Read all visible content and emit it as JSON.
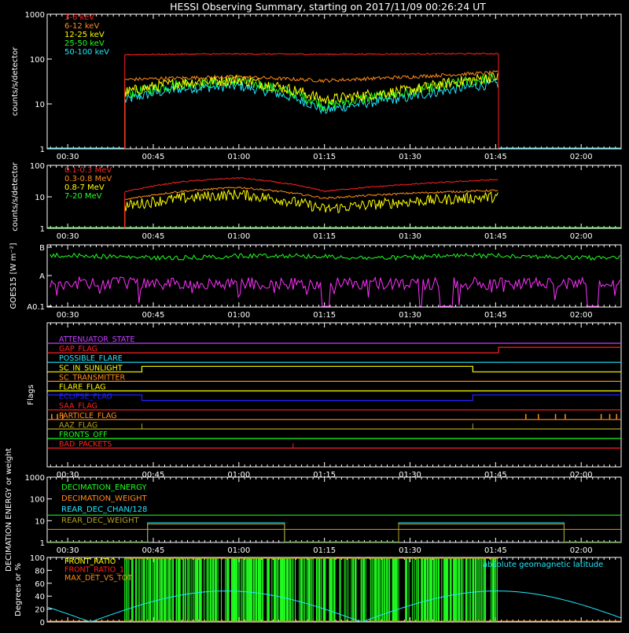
{
  "title": "HESSI Observing Summary, starting on 2017/11/09 00:26:24 UT",
  "time_axis": {
    "start": "00:26:24",
    "end": "02:07:00",
    "tick_labels": [
      "00:30",
      "00:45",
      "01:00",
      "01:15",
      "01:30",
      "01:45",
      "02:00"
    ],
    "tick_minutes": [
      30,
      45,
      60,
      75,
      90,
      105,
      120
    ]
  },
  "colors": {
    "red": "#ff2020",
    "orange": "#ff8c1a",
    "yellow": "#ffff00",
    "green": "#20ff20",
    "cyan": "#20e8ff",
    "magenta": "#ff30ff",
    "blue": "#2020ff",
    "purple": "#c040ff",
    "olive": "#b0a020",
    "white": "#ffffff"
  },
  "chart_data": [
    {
      "type": "line",
      "ylabel": "counts/s/detector",
      "yscale": "log",
      "ylim": [
        1,
        1000
      ],
      "ytick_labels": [
        "1",
        "10",
        "100",
        "1000"
      ],
      "ytick_values": [
        1,
        10,
        100,
        1000
      ],
      "observation_window": [
        "00:40:00",
        "01:45:30"
      ],
      "series": [
        {
          "name": "3-6 keV",
          "color": "#ff2020",
          "x": [
            "00:40",
            "00:50",
            "01:00",
            "01:15",
            "01:30",
            "01:45"
          ],
          "y": [
            125,
            128,
            130,
            128,
            130,
            132
          ]
        },
        {
          "name": "6-12 keV",
          "color": "#ff8c1a",
          "x": [
            "00:40",
            "00:50",
            "01:00",
            "01:15",
            "01:30",
            "01:45"
          ],
          "y": [
            35,
            38,
            40,
            33,
            40,
            50
          ]
        },
        {
          "name": "12-25 keV",
          "color": "#ffff00",
          "x": [
            "00:40",
            "00:50",
            "01:00",
            "01:15",
            "01:30",
            "01:45"
          ],
          "y": [
            18,
            30,
            35,
            12,
            20,
            40
          ]
        },
        {
          "name": "25-50 keV",
          "color": "#20ff20",
          "x": [
            "00:40",
            "00:50",
            "01:00",
            "01:15",
            "01:30",
            "01:45"
          ],
          "y": [
            16,
            28,
            32,
            9,
            18,
            38
          ]
        },
        {
          "name": "50-100 keV",
          "color": "#20e8ff",
          "x": [
            "00:40",
            "00:50",
            "01:00",
            "01:15",
            "01:30",
            "01:45"
          ],
          "y": [
            12,
            22,
            25,
            7,
            14,
            28
          ]
        }
      ]
    },
    {
      "type": "line",
      "ylabel": "counts/s/detector",
      "yscale": "log",
      "ylim": [
        1,
        100
      ],
      "ytick_labels": [
        "1",
        "10",
        "100"
      ],
      "ytick_values": [
        1,
        10,
        100
      ],
      "series": [
        {
          "name": "0.1-0.3 MeV",
          "color": "#ff2020",
          "x": [
            "00:40",
            "00:50",
            "01:00",
            "01:15",
            "01:30",
            "01:45"
          ],
          "y": [
            14,
            30,
            40,
            15,
            25,
            35
          ]
        },
        {
          "name": "0.3-0.8 MeV",
          "color": "#ff8c1a",
          "x": [
            "00:40",
            "00:50",
            "01:00",
            "01:15",
            "01:30",
            "01:45"
          ],
          "y": [
            8,
            15,
            20,
            9,
            13,
            16
          ]
        },
        {
          "name": "0.8-7 MeV",
          "color": "#ffff00",
          "x": [
            "00:40",
            "00:50",
            "01:00",
            "01:15",
            "01:30",
            "01:45"
          ],
          "y": [
            5,
            9,
            12,
            4,
            7,
            10
          ]
        },
        {
          "name": "7-20 MeV",
          "color": "#20ff20",
          "x": [
            "00:40",
            "00:50",
            "01:00",
            "01:15",
            "01:30",
            "01:45"
          ],
          "y": [
            1,
            1,
            1,
            1,
            1,
            1
          ]
        }
      ]
    },
    {
      "type": "line",
      "ylabel": "GOES15 [W m⁻²]",
      "ytick_labels": [
        "A0.1",
        "A",
        "B"
      ],
      "series": [
        {
          "color": "#20ff20",
          "level": "B"
        },
        {
          "color": "#ff30ff",
          "level": "A"
        }
      ]
    },
    {
      "type": "step",
      "ylabel": "Flags",
      "flags": [
        {
          "name": "ATTENUATOR_STATE",
          "color": "#c040ff"
        },
        {
          "name": "GAP_FLAG",
          "color": "#ff2020"
        },
        {
          "name": "POSSIBLE_FLARE",
          "color": "#20e8ff"
        },
        {
          "name": "SC_IN_SUNLIGHT",
          "color": "#ffff00"
        },
        {
          "name": "SC_TRANSMITTER",
          "color": "#ff8c1a"
        },
        {
          "name": "FLARE_FLAG",
          "color": "#ffff00"
        },
        {
          "name": "ECLIPSE_FLAG",
          "color": "#2020ff"
        },
        {
          "name": "SAA_FLAG",
          "color": "#ff2020"
        },
        {
          "name": "PARTICLE_FLAG",
          "color": "#ff8c1a"
        },
        {
          "name": "AAZ_FLAG",
          "color": "#b0a020"
        },
        {
          "name": "FRONTS_OFF",
          "color": "#20ff20"
        },
        {
          "name": "BAD_PACKETS",
          "color": "#ff2020"
        }
      ]
    },
    {
      "type": "line",
      "ylabel": "DECIMATION ENERGY or weight",
      "yscale": "log",
      "ylim": [
        1,
        1000
      ],
      "ytick_labels": [
        "1",
        "10",
        "100",
        "1000"
      ],
      "ytick_values": [
        1,
        10,
        100,
        1000
      ],
      "series": [
        {
          "name": "DECIMATION_ENERGY",
          "color": "#20ff20"
        },
        {
          "name": "DECIMATION_WEIGHT",
          "color": "#ff8c1a"
        },
        {
          "name": "REAR_DEC_CHAN/128",
          "color": "#20e8ff"
        },
        {
          "name": "REAR_DEC_WEIGHT",
          "color": "#b0a020"
        }
      ]
    },
    {
      "type": "line",
      "ylabel": "Degrees or %",
      "ylim": [
        0,
        100
      ],
      "ytick_labels": [
        "0",
        "20",
        "40",
        "60",
        "80",
        "100"
      ],
      "ytick_values": [
        0,
        20,
        40,
        60,
        80,
        100
      ],
      "series": [
        {
          "name": "FRONT_RATIO",
          "color": "#ffff00"
        },
        {
          "name": "FRONT_RATIO_1",
          "color": "#ff2020"
        },
        {
          "name": "MAX_DET_VS_TOT",
          "color": "#ff8c1a"
        },
        {
          "name": "absolute geomagnetic latitude",
          "color": "#20e8ff",
          "x": [
            "00:26",
            "00:34",
            "00:58",
            "01:20",
            "01:44",
            "02:06"
          ],
          "y": [
            20,
            0,
            48,
            0,
            48,
            5
          ]
        }
      ]
    }
  ]
}
